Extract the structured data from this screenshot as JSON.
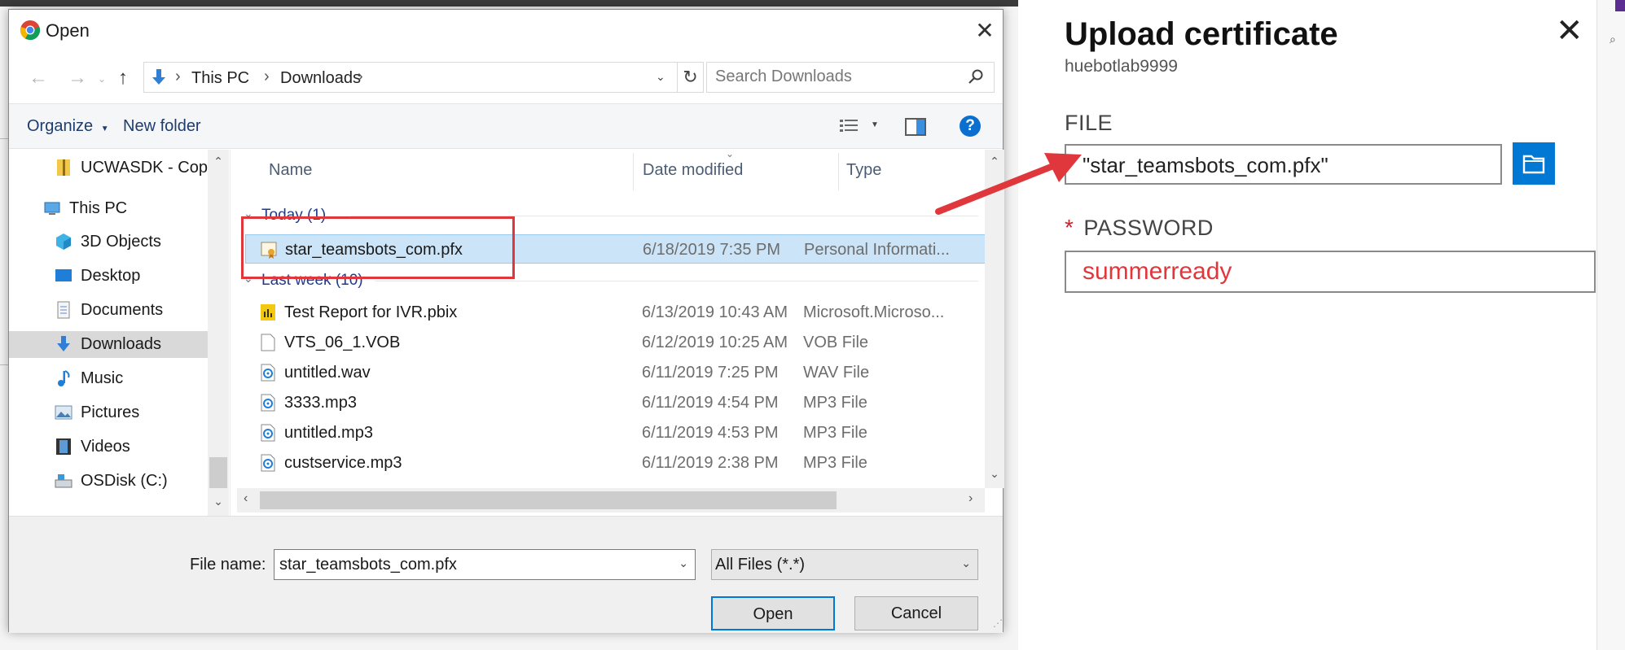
{
  "dialog": {
    "title": "Open",
    "address": {
      "segments": [
        "This PC",
        "Downloads"
      ]
    },
    "search": {
      "placeholder": "Search Downloads"
    },
    "toolbar": {
      "organize": "Organize",
      "new_folder": "New folder",
      "help": "?"
    },
    "nav": [
      {
        "label": "UCWASDK - Cop",
        "icon": "zip-folder-icon"
      },
      {
        "label": "This PC",
        "icon": "computer-icon"
      },
      {
        "label": "3D Objects",
        "icon": "cube-icon"
      },
      {
        "label": "Desktop",
        "icon": "desktop-icon"
      },
      {
        "label": "Documents",
        "icon": "documents-icon"
      },
      {
        "label": "Downloads",
        "icon": "download-arrow-icon",
        "selected": true
      },
      {
        "label": "Music",
        "icon": "music-note-icon"
      },
      {
        "label": "Pictures",
        "icon": "pictures-icon"
      },
      {
        "label": "Videos",
        "icon": "film-icon"
      },
      {
        "label": "OSDisk (C:)",
        "icon": "drive-icon"
      }
    ],
    "columns": {
      "name": "Name",
      "date": "Date modified",
      "type": "Type"
    },
    "groups": [
      {
        "title": "Today (1)",
        "files": [
          {
            "name": "star_teamsbots_com.pfx",
            "date": "6/18/2019 7:35 PM",
            "type": "Personal Informati...",
            "icon": "certificate-icon",
            "selected": true
          }
        ]
      },
      {
        "title": "Last week (10)",
        "files": [
          {
            "name": "Test Report for IVR.pbix",
            "date": "6/13/2019 10:43 AM",
            "type": "Microsoft.Microso...",
            "icon": "pbix-file-icon"
          },
          {
            "name": "VTS_06_1.VOB",
            "date": "6/12/2019 10:25 AM",
            "type": "VOB File",
            "icon": "blank-file-icon"
          },
          {
            "name": "untitled.wav",
            "date": "6/11/2019 7:25 PM",
            "type": "WAV File",
            "icon": "audio-file-icon"
          },
          {
            "name": "3333.mp3",
            "date": "6/11/2019 4:54 PM",
            "type": "MP3 File",
            "icon": "audio-file-icon"
          },
          {
            "name": "untitled.mp3",
            "date": "6/11/2019 4:53 PM",
            "type": "MP3 File",
            "icon": "audio-file-icon"
          },
          {
            "name": "custservice.mp3",
            "date": "6/11/2019 2:38 PM",
            "type": "MP3 File",
            "icon": "audio-file-icon"
          }
        ]
      }
    ],
    "filename": {
      "label": "File name:",
      "value": "star_teamsbots_com.pfx"
    },
    "filetype": {
      "value": "All Files (*.*)"
    },
    "buttons": {
      "open": "Open",
      "cancel": "Cancel"
    }
  },
  "panel": {
    "title": "Upload certificate",
    "subtitle": "huebotlab9999",
    "file_label": "FILE",
    "file_value": "\"star_teamsbots_com.pfx\"",
    "password_required": "*",
    "password_label": "PASSWORD",
    "password_value": "summerready"
  },
  "colors": {
    "accent": "#0078d4",
    "annotation_red": "#e0373c",
    "password_text": "#e0373c",
    "selected_row": "#cce4f7"
  }
}
